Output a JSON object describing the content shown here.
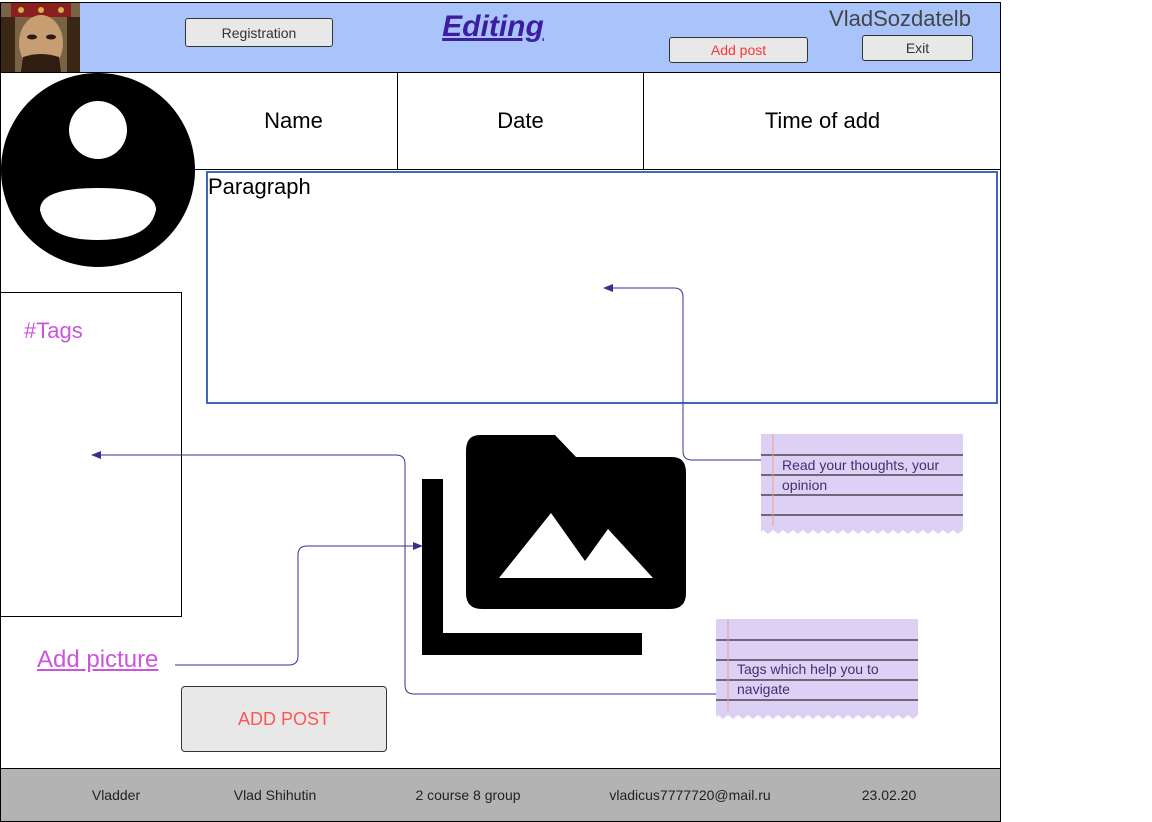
{
  "header": {
    "title": "Editing",
    "username": "VladSozdatelb",
    "registration_label": "Registration",
    "add_post_label": "Add post",
    "exit_label": "Exit"
  },
  "columns": {
    "name": "Name",
    "date": "Date",
    "time": "Time of add"
  },
  "content": {
    "paragraph_label": "Paragraph",
    "tags_label": "#Tags",
    "add_picture_label": "Add picture",
    "add_post_button": "ADD POST"
  },
  "notes": {
    "paragraph_note": "Read your thoughts, your opinion",
    "tags_note": "Tags which help you to navigate"
  },
  "footer": {
    "site": "Vladder",
    "author": "Vlad Shihutin",
    "group": "2 course 8 group",
    "email": "vladicus7777720@mail.ru",
    "date": "23.02.20"
  },
  "colors": {
    "header_bg": "#a9c4fb",
    "title": "#3d1ea0",
    "accent_pink": "#cc55dd",
    "danger_text": "#ff3333",
    "note_bg": "#ddd0f5",
    "connector": "#3d2e8c",
    "footer_bg": "#b3b3b3"
  },
  "icons": [
    "portrait-image",
    "user-avatar-icon",
    "photo-library-icon"
  ]
}
